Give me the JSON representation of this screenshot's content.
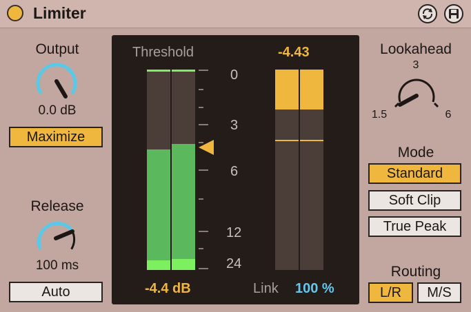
{
  "device": {
    "title": "Limiter"
  },
  "output": {
    "label": "Output",
    "value": "0.0 dB",
    "maximize_label": "Maximize"
  },
  "release": {
    "label": "Release",
    "value": "100 ms",
    "auto_label": "Auto"
  },
  "meter": {
    "threshold_label": "Threshold",
    "threshold_value": "-4.4 dB",
    "gr_value": "-4.43",
    "scale": [
      "0",
      "3",
      "6",
      "12",
      "24"
    ],
    "link_label": "Link",
    "link_value": "100 %",
    "left_level": 0.6,
    "right_level": 0.63,
    "gr_fill": 0.2
  },
  "lookahead": {
    "label": "Lookahead",
    "min": "1.5",
    "mid": "3",
    "max": "6"
  },
  "mode": {
    "label": "Mode",
    "options": [
      "Standard",
      "Soft Clip",
      "True Peak"
    ],
    "selected": "Standard"
  },
  "routing": {
    "label": "Routing",
    "options": [
      "L/R",
      "M/S"
    ],
    "selected": "L/R"
  },
  "colors": {
    "accent": "#f0b73e",
    "meter_green": "#5cb85c",
    "knob_blue": "#5bc8e6",
    "link_blue": "#64c8ee"
  }
}
